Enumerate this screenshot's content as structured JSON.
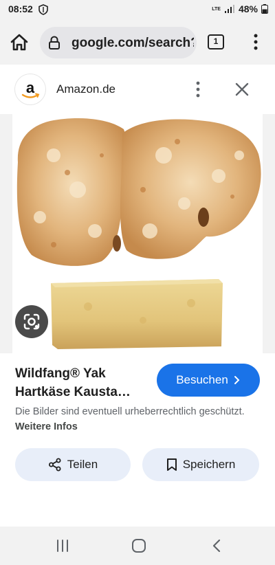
{
  "status_bar": {
    "time": "08:52",
    "network_type": "LTE",
    "battery_percent": "48%",
    "icons": [
      "shield-icon",
      "signal-icon",
      "battery-icon"
    ]
  },
  "browser": {
    "url": "google.com/search?",
    "tab_count": "1",
    "icons": [
      "home-icon",
      "lock-icon",
      "tabs-icon",
      "more-vert-icon"
    ]
  },
  "source": {
    "logo_letter": "a",
    "name": "Amazon.de",
    "icons": [
      "more-vert-icon",
      "close-icon"
    ]
  },
  "image": {
    "subject": "yak-cheese-chew-photo",
    "icons": [
      "lens-icon"
    ]
  },
  "result": {
    "title": "Wildfang® Yak Hartkäse Kausta…",
    "visit_label": "Besuchen",
    "copyright_text": "Die Bilder sind eventuell urheberrechtlich geschützt.",
    "more_info_label": "Weitere Infos"
  },
  "actions": {
    "share_label": "Teilen",
    "save_label": "Speichern"
  },
  "colors": {
    "accent": "#1a73e8",
    "action_bg": "#e8eef9",
    "chrome_bg": "#f2f2f2"
  }
}
